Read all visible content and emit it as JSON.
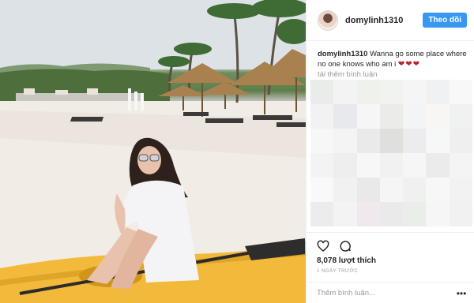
{
  "post": {
    "username": "domylinh1310",
    "follow_label": "Theo dõi",
    "caption_user": "domylinh1310",
    "caption_text": "Wanna go some place where no one knows who am i",
    "caption_emoji": "❤❤❤",
    "load_more": "tải thêm bình luận",
    "likes": "8,078 lượt thích",
    "time": "1 NGÀY TRƯỚC",
    "comment_placeholder": "Thêm bình luận..."
  },
  "icons": {
    "like": "heart-icon",
    "comment": "comment-icon",
    "more": "more-options-icon"
  },
  "colors": {
    "accent": "#3897f0",
    "hearts": "#b3242d",
    "kayak": "#f2b93b"
  }
}
